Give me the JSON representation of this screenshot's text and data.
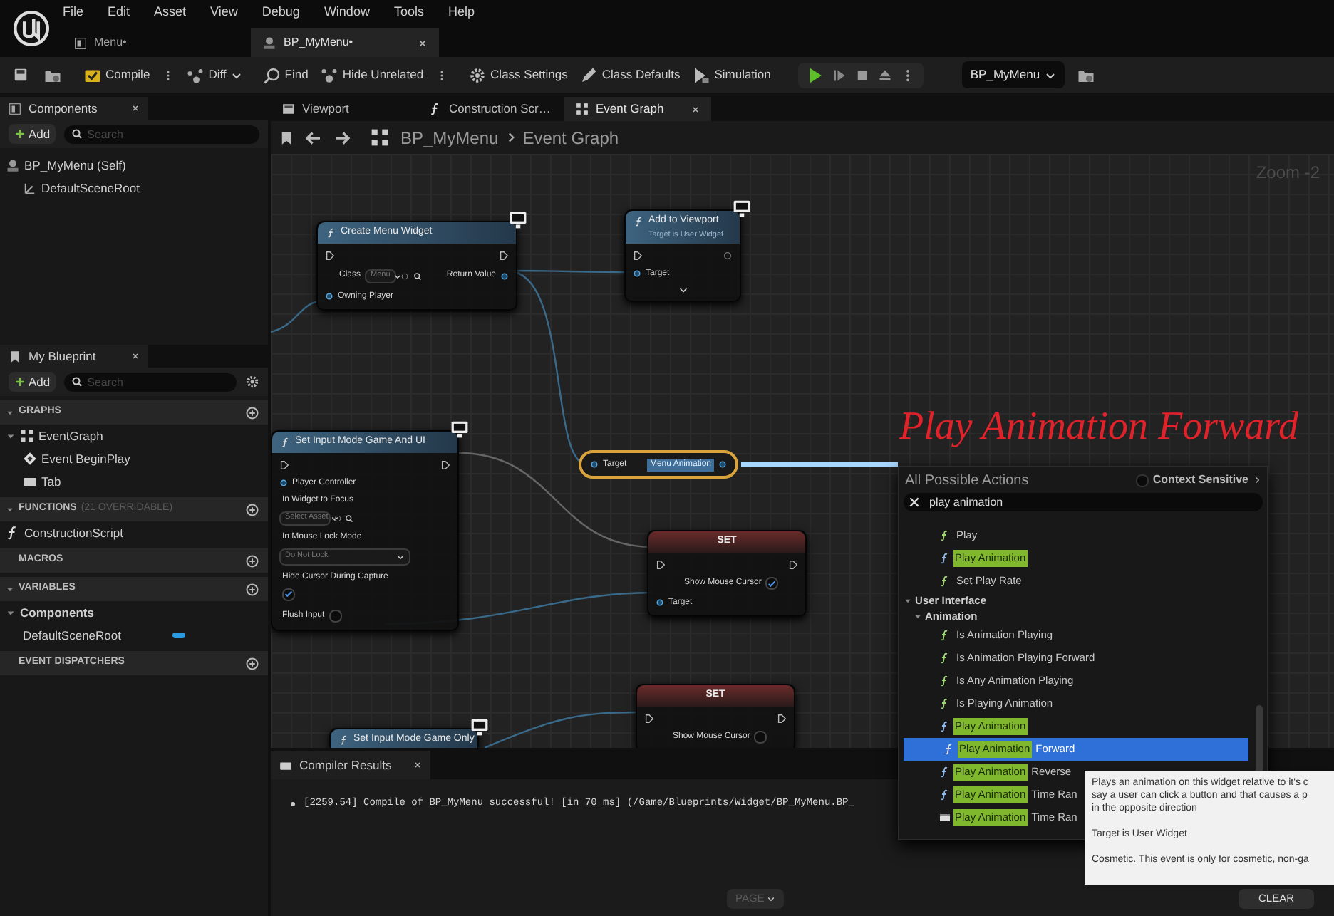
{
  "title_bar": {
    "menu": [
      "File",
      "Edit",
      "Asset",
      "View",
      "Debug",
      "Window",
      "Tools",
      "Help"
    ],
    "documents": [
      {
        "label": "Menu•",
        "kind": "widget",
        "selected": false
      },
      {
        "label": "BP_MyMenu•",
        "kind": "blueprint",
        "selected": true
      }
    ]
  },
  "toolbar": {
    "buttons": [
      "Compile",
      "Diff",
      "Find",
      "Hide Unrelated",
      "Class Settings",
      "Class Defaults",
      "Simulation"
    ],
    "debug_target": "BP_MyMenu"
  },
  "components": {
    "tab": "Components",
    "add": "Add",
    "search_placeholder": "Search",
    "tree": [
      {
        "label": "BP_MyMenu (Self)",
        "kind": "self",
        "children": [
          {
            "label": "DefaultSceneRoot",
            "kind": "scene"
          }
        ]
      }
    ]
  },
  "my_blueprint": {
    "tab": "My Blueprint",
    "add": "Add",
    "search_placeholder": "Search",
    "sections": [
      {
        "title": "GRAPHS",
        "expanded": true,
        "items": [
          {
            "label": "EventGraph",
            "kind": "graph",
            "expanded": true,
            "children": [
              {
                "label": "Event BeginPlay",
                "kind": "event"
              },
              {
                "label": "Tab",
                "kind": "tab"
              }
            ]
          }
        ]
      },
      {
        "title": "FUNCTIONS",
        "note": "(21 OVERRIDABLE)",
        "expanded": true,
        "items": [
          {
            "label": "ConstructionScript",
            "kind": "function"
          }
        ]
      },
      {
        "title": "MACROS",
        "expanded": false
      },
      {
        "title": "VARIABLES",
        "expanded": true,
        "items": [
          {
            "label": "Components",
            "kind": "category",
            "expanded": true,
            "children": [
              {
                "label": "DefaultSceneRoot",
                "kind": "variable",
                "color": "#2a9be0"
              }
            ]
          }
        ]
      },
      {
        "title": "EVENT DISPATCHERS",
        "expanded": false
      }
    ]
  },
  "editor_tabs": [
    {
      "label": "Viewport",
      "kind": "viewport",
      "selected": false
    },
    {
      "label": "Construction Scr…",
      "kind": "function",
      "selected": false
    },
    {
      "label": "Event Graph",
      "kind": "graph",
      "selected": true
    }
  ],
  "breadcrumb": [
    "BP_MyMenu",
    "Event Graph"
  ],
  "graph": {
    "zoom": "Zoom -2",
    "annotation": "Play Animation Forward",
    "nodes": [
      {
        "kind": "function",
        "title": "Create Menu Widget",
        "monitor_badge": true,
        "rows": [
          {
            "kind": "exec"
          },
          {
            "kind": "asset",
            "label": "Class",
            "value": "Menu",
            "output": "Return Value",
            "stacked": false
          },
          {
            "kind": "pin",
            "label": "Owning Player"
          }
        ]
      },
      {
        "kind": "function",
        "title": "Add to Viewport",
        "subtitle": "Target is User Widget",
        "monitor_badge": true,
        "rows": [
          {
            "kind": "exec"
          },
          {
            "kind": "pin",
            "label": "Target"
          },
          {
            "kind": "advanced"
          }
        ]
      },
      {
        "kind": "function",
        "title": "Set Input Mode Game And UI",
        "monitor_badge": true,
        "rows": [
          {
            "kind": "exec"
          },
          {
            "kind": "pin",
            "label": "Player Controller"
          },
          {
            "kind": "asset",
            "label": "In Widget to Focus",
            "value": "Select Asset",
            "stacked": true
          },
          {
            "kind": "enum",
            "label": "In Mouse Lock Mode",
            "value": "Do Not Lock"
          },
          {
            "kind": "checkbox",
            "label": "Hide Cursor During Capture",
            "checked": true,
            "stacked": true
          },
          {
            "kind": "checkbox",
            "label": "Flush Input",
            "checked": false,
            "stacked": false
          }
        ]
      },
      {
        "kind": "set",
        "title": "SET",
        "monitor_badge": false,
        "rows": [
          {
            "kind": "exec"
          },
          {
            "kind": "checkbox",
            "label": "Show Mouse Cursor",
            "checked": true,
            "stacked": false
          },
          {
            "kind": "pin",
            "label": "Target"
          }
        ]
      },
      {
        "kind": "set",
        "title": "SET",
        "monitor_badge": false,
        "rows": [
          {
            "kind": "exec"
          },
          {
            "kind": "checkbox",
            "label": "Show Mouse Cursor",
            "checked": false,
            "stacked": false
          }
        ]
      },
      {
        "kind": "function",
        "title": "Set Input Mode Game Only",
        "monitor_badge": true
      }
    ],
    "getter": {
      "input": "Target",
      "output": "Menu Animation"
    }
  },
  "action_menu": {
    "title": "All Possible Actions",
    "context_sensitive": {
      "label": "Context Sensitive",
      "checked": false
    },
    "search": "play animation",
    "items": [
      {
        "kind": "function",
        "text": "Play",
        "selected": false
      },
      {
        "kind": "function",
        "highlight": "Play Animation",
        "selected": false
      },
      {
        "kind": "function",
        "text": "Set Play Rate",
        "selected": false
      },
      {
        "kind": "category",
        "text": "User Interface",
        "expanded": true,
        "children": [
          {
            "kind": "category",
            "text": "Animation",
            "expanded": true,
            "children": [
              {
                "kind": "function",
                "text": "Is Animation Playing",
                "selected": false
              },
              {
                "kind": "function",
                "text": "Is Animation Playing Forward",
                "selected": false
              },
              {
                "kind": "function",
                "text": "Is Any Animation Playing",
                "selected": false
              },
              {
                "kind": "function",
                "text": "Is Playing Animation",
                "selected": false
              },
              {
                "kind": "function",
                "highlight": "Play Animation",
                "selected": false
              },
              {
                "kind": "function",
                "highlight": "Play Animation",
                "text": "Forward",
                "selected": true
              },
              {
                "kind": "function",
                "highlight": "Play Animation",
                "text": "Reverse",
                "selected": false
              },
              {
                "kind": "function",
                "highlight": "Play Animation",
                "text": "Time Ran",
                "selected": false
              },
              {
                "kind": "event",
                "highlight": "Play Animation",
                "text": "Time Ran",
                "selected": false
              }
            ]
          }
        ]
      }
    ],
    "tooltip": [
      "Plays an animation on this widget relative to it's c",
      "say a user can click a button and that causes a p",
      "in the opposite direction",
      "Target is User Widget",
      "Cosmetic. This event is only for cosmetic, non-ga"
    ]
  },
  "compiler": {
    "tab": "Compiler Results",
    "messages": [
      "[2259.54] Compile of BP_MyMenu successful! [in 70 ms] (/Game/Blueprints/Widget/BP_MyMenu.BP_"
    ],
    "page": {
      "label": "PAGE",
      "disabled": true
    },
    "clear": "CLEAR"
  }
}
